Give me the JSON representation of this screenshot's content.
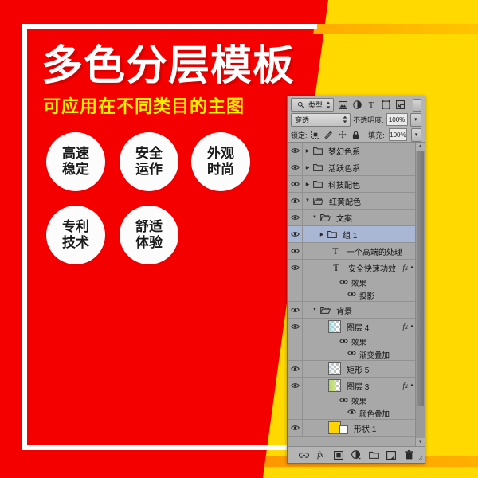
{
  "poster": {
    "headline": "多色分层模板",
    "subline": "可应用在不同类目的主图",
    "colors": {
      "red": "#F40000",
      "yellow": "#FFD900",
      "orange": "#FF8C00",
      "white": "#FFFFFF",
      "sub_text": "#FFF200"
    },
    "badges": [
      {
        "line1": "高速",
        "line2": "稳定"
      },
      {
        "line1": "安全",
        "line2": "运作"
      },
      {
        "line1": "外观",
        "line2": "时尚"
      },
      {
        "line1": "专利",
        "line2": "技术"
      },
      {
        "line1": "舒适",
        "line2": "体验"
      }
    ]
  },
  "layers_panel": {
    "filter": {
      "kind_label": "类型",
      "search_icon": "search-icon",
      "filter_icons": [
        "pixel-layer-filter-icon",
        "adjustment-layer-filter-icon",
        "type-layer-filter-icon",
        "shape-layer-filter-icon",
        "smart-object-filter-icon"
      ],
      "toggle_label": "filter-toggle"
    },
    "blend": {
      "mode": "穿透",
      "opacity_label": "不透明度:",
      "opacity_value": "100%"
    },
    "lock": {
      "label": "锁定:",
      "icons": [
        "lock-transparent-pixels-icon",
        "lock-image-pixels-icon",
        "lock-position-icon",
        "lock-all-icon"
      ],
      "fill_label": "填充:",
      "fill_value": "100%"
    },
    "rows": [
      {
        "type": "group",
        "indent": 0,
        "twirl": "right",
        "name": "梦幻色系",
        "visible": true,
        "selected": false,
        "fx": false
      },
      {
        "type": "group",
        "indent": 0,
        "twirl": "right",
        "name": "活跃色系",
        "visible": true,
        "selected": false,
        "fx": false
      },
      {
        "type": "group",
        "indent": 0,
        "twirl": "right",
        "name": "科技配色",
        "visible": true,
        "selected": false,
        "fx": false
      },
      {
        "type": "group",
        "indent": 0,
        "twirl": "down",
        "name": "红黄配色",
        "visible": true,
        "selected": false,
        "fx": false
      },
      {
        "type": "group",
        "indent": 1,
        "twirl": "down",
        "name": "文案",
        "visible": true,
        "selected": false,
        "fx": false
      },
      {
        "type": "group",
        "indent": 2,
        "twirl": "right",
        "name": "组 1",
        "visible": true,
        "selected": true,
        "fx": false
      },
      {
        "type": "text",
        "indent": 2,
        "name": "一个高端的处理…",
        "visible": true,
        "selected": false,
        "fx": false
      },
      {
        "type": "text",
        "indent": 2,
        "name": "安全快速功效",
        "visible": true,
        "selected": false,
        "fx": true,
        "effects": {
          "label": "效果",
          "items": [
            "投影"
          ]
        }
      },
      {
        "type": "group",
        "indent": 1,
        "twirl": "down",
        "name": "背景",
        "visible": true,
        "selected": false,
        "fx": false
      },
      {
        "type": "pixel",
        "indent": 2,
        "name": "图层 4",
        "visible": true,
        "selected": false,
        "fx": true,
        "thumb": "transparent-cyan",
        "effects": {
          "label": "效果",
          "items": [
            "渐变叠加"
          ]
        }
      },
      {
        "type": "pixel",
        "indent": 2,
        "name": "矩形 5",
        "visible": true,
        "selected": false,
        "fx": false,
        "thumb": "transparent-pale"
      },
      {
        "type": "pixel",
        "indent": 2,
        "name": "图层 3",
        "visible": true,
        "selected": false,
        "fx": true,
        "thumb": "green-gradient",
        "effects": {
          "label": "效果",
          "items": [
            "颜色叠加"
          ]
        }
      },
      {
        "type": "shape",
        "indent": 2,
        "name": "形状 1",
        "visible": true,
        "selected": false,
        "fx": false,
        "thumb": "yellow-solid"
      }
    ],
    "footer_icons": [
      "link-layers-icon",
      "add-layer-style-fx-icon",
      "add-layer-mask-icon",
      "new-adjustment-layer-icon",
      "new-group-icon",
      "new-layer-icon",
      "delete-layer-icon"
    ]
  }
}
